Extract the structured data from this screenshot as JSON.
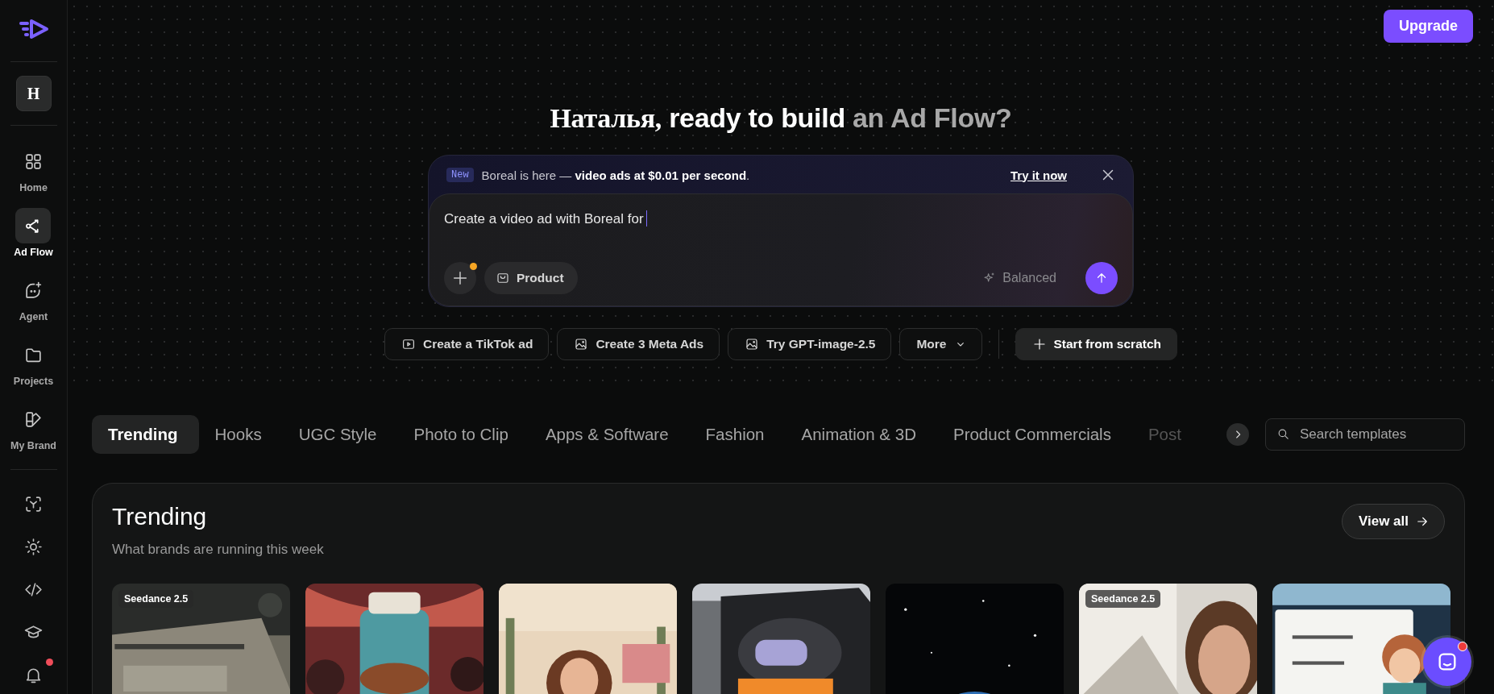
{
  "sidebar": {
    "workspace": "H",
    "items": [
      {
        "label": "Home",
        "selected": false
      },
      {
        "label": "Ad Flow",
        "selected": true
      },
      {
        "label": "Agent",
        "selected": false
      },
      {
        "label": "Projects",
        "selected": false
      },
      {
        "label": "My Brand",
        "selected": false
      }
    ],
    "notifications": {
      "badge": true
    }
  },
  "upgrade": "Upgrade",
  "headline": {
    "name": "Наталья,",
    "lead": "ready to build",
    "accent": "an Ad Flow?"
  },
  "banner": {
    "tag": "New",
    "text": "Boreal is here — **video ads at $0.01 per second**.",
    "link": "Try it now"
  },
  "prompt": {
    "value": "Create a video ad with Boreal for",
    "attachment_dot": true,
    "chip": "Product",
    "mode": "Balanced"
  },
  "suggestions": [
    {
      "label": "Create a TikTok ad",
      "kind": "template"
    },
    {
      "label": "Create 3 Meta Ads",
      "kind": "template"
    },
    {
      "label": "Try GPT-image-2.5",
      "kind": "template"
    },
    {
      "label": "More",
      "kind": "menu"
    },
    {
      "label": "Start from scratch",
      "kind": "action"
    }
  ],
  "tabs": [
    {
      "label": "Trending",
      "selected": true
    },
    {
      "label": "Hooks",
      "selected": false
    },
    {
      "label": "UGC Style",
      "selected": false
    },
    {
      "label": "Photo to Clip",
      "selected": false
    },
    {
      "label": "Apps & Software",
      "selected": false
    },
    {
      "label": "Fashion",
      "selected": false
    },
    {
      "label": "Animation & 3D",
      "selected": false
    },
    {
      "label": "Product Commercials",
      "selected": false
    },
    {
      "label": "Post",
      "selected": false
    }
  ],
  "search": {
    "placeholder": "Search templates"
  },
  "section": {
    "title": "Trending",
    "subtitle": "What brands are running this week",
    "action": "View all",
    "cards": [
      {
        "kind": "picture",
        "badge": "Seedance 2.5"
      },
      {
        "kind": "picture"
      },
      {
        "kind": "picture"
      },
      {
        "kind": "picture"
      },
      {
        "kind": "picture"
      },
      {
        "kind": "picture",
        "badge": "Seedance 2.5"
      },
      {
        "kind": "picture"
      }
    ]
  },
  "chat": {
    "badge": true
  }
}
